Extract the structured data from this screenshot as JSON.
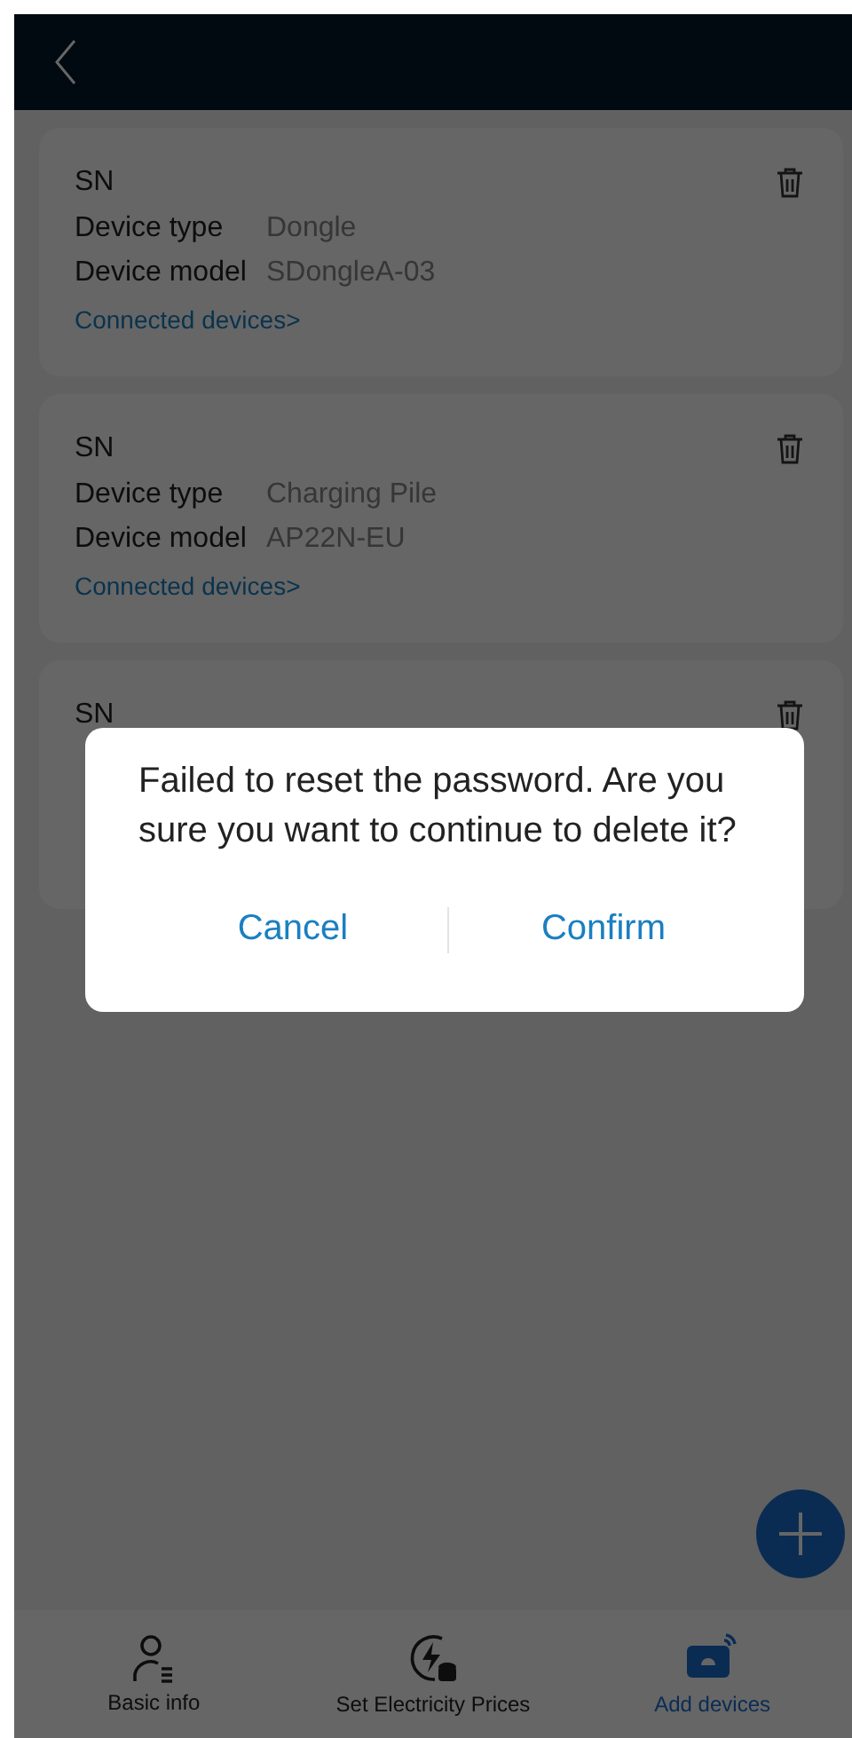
{
  "cards": [
    {
      "sn_label": "SN",
      "rows": [
        {
          "label": "Device type",
          "value": "Dongle"
        },
        {
          "label": "Device model",
          "value": "SDongleA-03"
        }
      ],
      "link": "Connected devices>"
    },
    {
      "sn_label": "SN",
      "rows": [
        {
          "label": "Device type",
          "value": "Charging Pile"
        },
        {
          "label": "Device model",
          "value": "AP22N-EU"
        }
      ],
      "link": "Connected devices>"
    },
    {
      "sn_label": "SN"
    }
  ],
  "dialog": {
    "message": "Failed to reset the password. Are you sure you want to continue to delete it?",
    "buttons": [
      "Cancel",
      "Confirm"
    ]
  },
  "nav": [
    {
      "label": "Basic info",
      "kind": "person",
      "selected": false
    },
    {
      "label": "Set Electricity Prices",
      "kind": "price",
      "selected": false
    },
    {
      "label": "Add devices",
      "kind": "device",
      "selected": true
    }
  ]
}
